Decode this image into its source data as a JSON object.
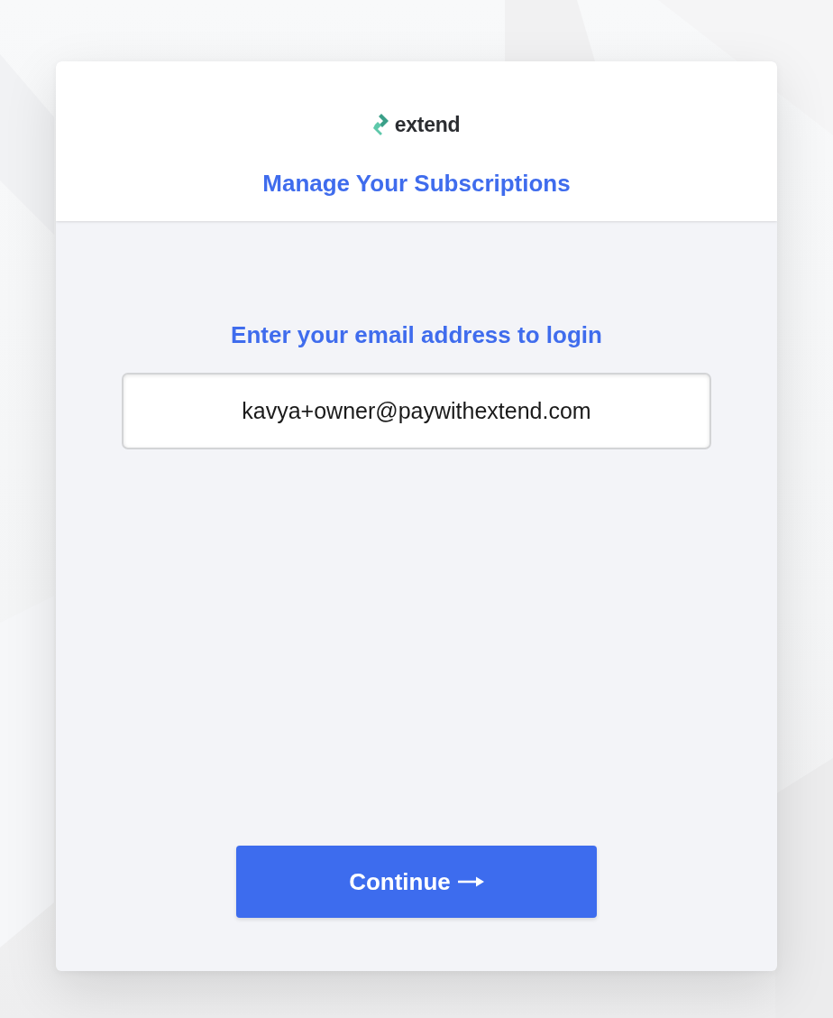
{
  "logo": {
    "wordmark": "extend"
  },
  "header": {
    "title": "Manage Your Subscriptions"
  },
  "form": {
    "prompt": "Enter your email address to login",
    "email": {
      "value": "kavya+owner@paywithextend.com"
    }
  },
  "continue_button": {
    "label": "Continue"
  }
}
